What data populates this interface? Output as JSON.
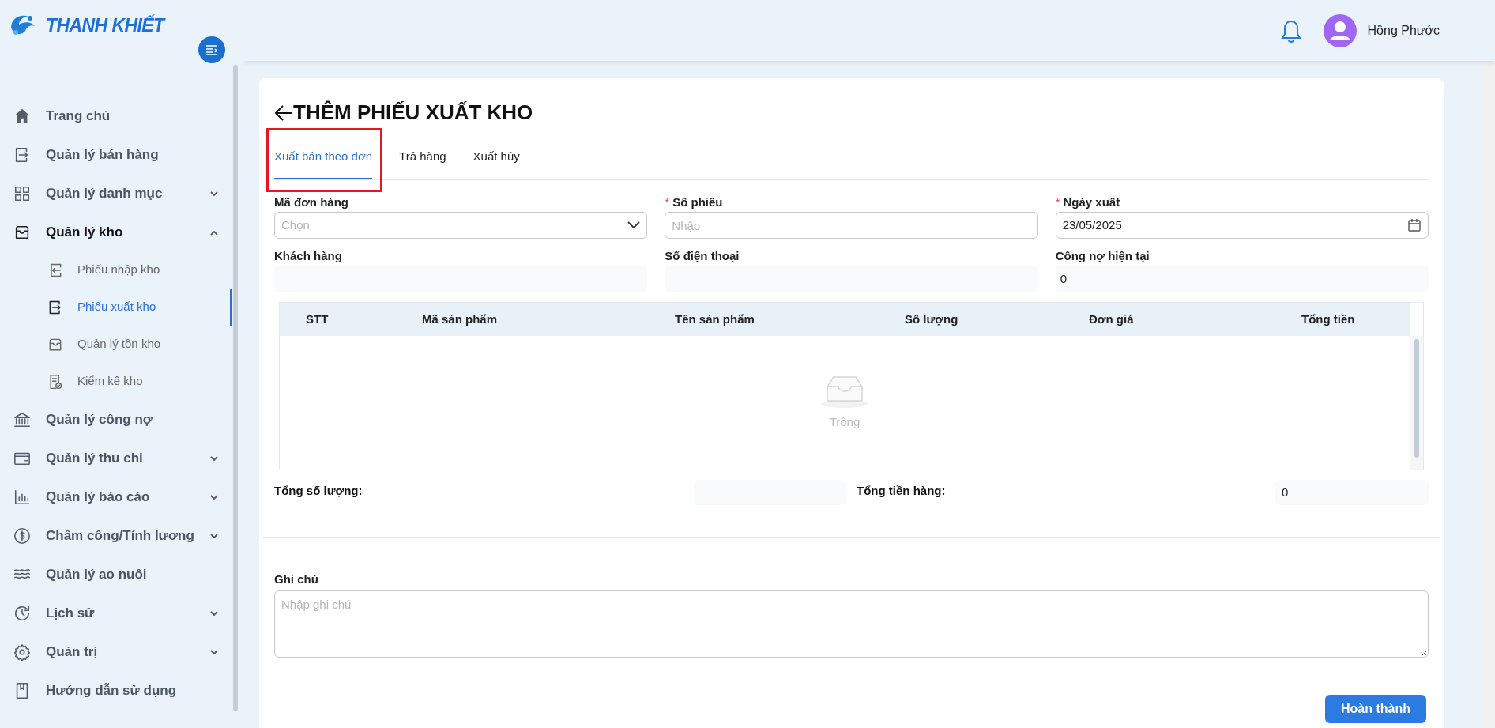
{
  "logo": {
    "text": "THANH KHIẾT"
  },
  "sidebar": {
    "items": [
      {
        "kind": "link",
        "label": "Trang chủ"
      },
      {
        "kind": "link",
        "label": "Quản lý bán hàng"
      },
      {
        "kind": "group",
        "label": "Quản lý danh mục",
        "expanded": false
      },
      {
        "kind": "group",
        "label": "Quản lý kho",
        "expanded": true,
        "children": [
          {
            "label": "Phiếu nhập kho",
            "selected": false
          },
          {
            "label": "Phiếu xuất kho",
            "selected": true
          },
          {
            "label": "Quản lý tồn kho",
            "selected": false
          },
          {
            "label": "Kiểm kê kho",
            "selected": false
          }
        ]
      },
      {
        "kind": "link",
        "label": "Quản lý công nợ"
      },
      {
        "kind": "group",
        "label": "Quản lý thu chi",
        "expanded": false
      },
      {
        "kind": "group",
        "label": "Quản lý báo cáo",
        "expanded": false
      },
      {
        "kind": "group",
        "label": "Chấm công/Tính lương",
        "expanded": false
      },
      {
        "kind": "link",
        "label": "Quản lý ao nuôi"
      },
      {
        "kind": "group",
        "label": "Lịch sử",
        "expanded": false
      },
      {
        "kind": "group",
        "label": "Quản trị",
        "expanded": false
      },
      {
        "kind": "link",
        "label": "Hướng dẫn sử dụng"
      }
    ]
  },
  "header": {
    "user": {
      "name": "Hồng Phước"
    }
  },
  "page": {
    "title": "THÊM PHIẾU XUẤT KHO",
    "tabs": [
      {
        "label": "Xuất bán theo đơn",
        "selected": true,
        "highlighted": true
      },
      {
        "label": "Trả hàng",
        "selected": false,
        "highlighted": false
      },
      {
        "label": "Xuất hủy",
        "selected": false,
        "highlighted": false
      }
    ],
    "fields": [
      {
        "kind": "select",
        "label": "Mã đơn hàng",
        "placeholder": "Chọn"
      },
      {
        "kind": "input",
        "required_mark": "*",
        "label": "Số phiếu",
        "placeholder": "Nhập"
      },
      {
        "kind": "date",
        "required_mark": "*",
        "label": "Ngày xuất",
        "value": "23/05/2025"
      },
      {
        "kind": "readonly",
        "label": "Khách hàng"
      },
      {
        "kind": "readonly",
        "label": "Số điện thoại"
      },
      {
        "kind": "readonly",
        "label": "Công nợ hiện tại",
        "value": "0"
      }
    ],
    "table": {
      "columns": [
        "STT",
        "Mã sản phẩm",
        "Tên sản phẩm",
        "Số lượng",
        "Đơn giá",
        "Tổng tiền"
      ],
      "empty_text": "Trống"
    },
    "totals": [
      {
        "label": "Tổng số lượng:"
      },
      {
        "label": "Tổng tiền hàng:",
        "value": "0"
      }
    ],
    "note": {
      "label": "Ghi chú",
      "placeholder": "Nhập ghi chú"
    },
    "submit_button": "Hoàn thành"
  }
}
